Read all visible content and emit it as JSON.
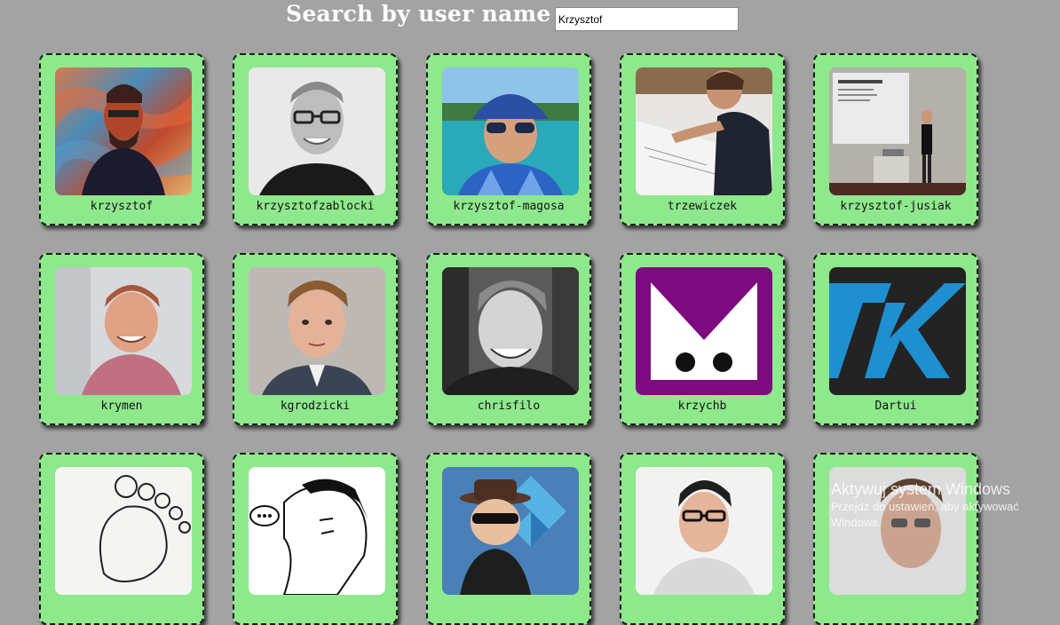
{
  "search": {
    "label": "Search by user name",
    "value": "Krzysztof"
  },
  "users": [
    {
      "name": "krzysztof",
      "avatar": "psychedelic-portrait"
    },
    {
      "name": "krzysztofzablocki",
      "avatar": "bw-portrait-glasses"
    },
    {
      "name": "krzysztof-magosa",
      "avatar": "cap-sunglasses-boat"
    },
    {
      "name": "trzewiczek",
      "avatar": "person-drawing-desk"
    },
    {
      "name": "krzysztof-jusiak",
      "avatar": "speaker-presentation"
    },
    {
      "name": "krymen",
      "avatar": "smiling-man-hoodie"
    },
    {
      "name": "kgrodzicki",
      "avatar": "man-suit-portrait"
    },
    {
      "name": "chrisfilo",
      "avatar": "bw-smiling-man-car"
    },
    {
      "name": "krzychb",
      "avatar": "purple-m-logo"
    },
    {
      "name": "Dartui",
      "avatar": "blue-k-logo"
    },
    {
      "name": "",
      "avatar": "footprint-sketch"
    },
    {
      "name": "",
      "avatar": "ink-drawing-face"
    },
    {
      "name": "",
      "avatar": "avatar-hat-sunglasses"
    },
    {
      "name": "",
      "avatar": "man-glasses-portrait"
    },
    {
      "name": "",
      "avatar": "man-portrait-partial"
    }
  ],
  "watermark": {
    "title": "Aktywuj system Windows",
    "line1": "Przejdź do ustawień, aby aktywować",
    "line2": "Windows."
  },
  "colors": {
    "background": "#a3a3a3",
    "card": "#8ee88c",
    "title": "#ffffff"
  }
}
